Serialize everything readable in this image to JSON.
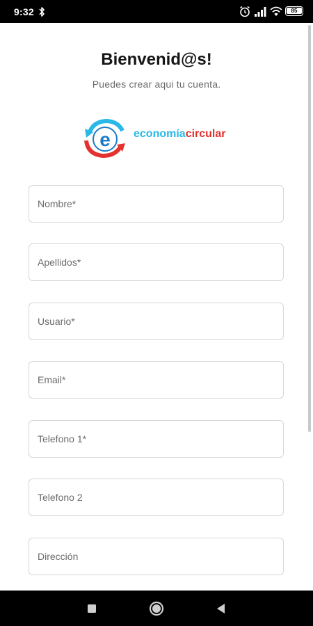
{
  "status_bar": {
    "time": "9:32",
    "battery": "85",
    "icons": [
      "bluetooth-icon",
      "alarm-icon",
      "signal-icon",
      "wifi-icon",
      "battery-icon"
    ]
  },
  "header": {
    "title": "Bienvenid@s!",
    "subtitle": "Puedes crear aqui tu cuenta."
  },
  "logo": {
    "text_part1": "economía",
    "text_part2": "circular",
    "colors": {
      "blue": "#29b8e8",
      "red": "#e3322f"
    }
  },
  "form": {
    "fields": [
      {
        "placeholder": "Nombre*"
      },
      {
        "placeholder": "Apellidos*"
      },
      {
        "placeholder": "Usuario*"
      },
      {
        "placeholder": "Email*"
      },
      {
        "placeholder": "Telefono 1*"
      },
      {
        "placeholder": "Telefono 2"
      },
      {
        "placeholder": "Dirección"
      }
    ]
  },
  "nav_bar": {
    "buttons": [
      "recents-square-icon",
      "home-circle-icon",
      "back-triangle-icon"
    ]
  }
}
